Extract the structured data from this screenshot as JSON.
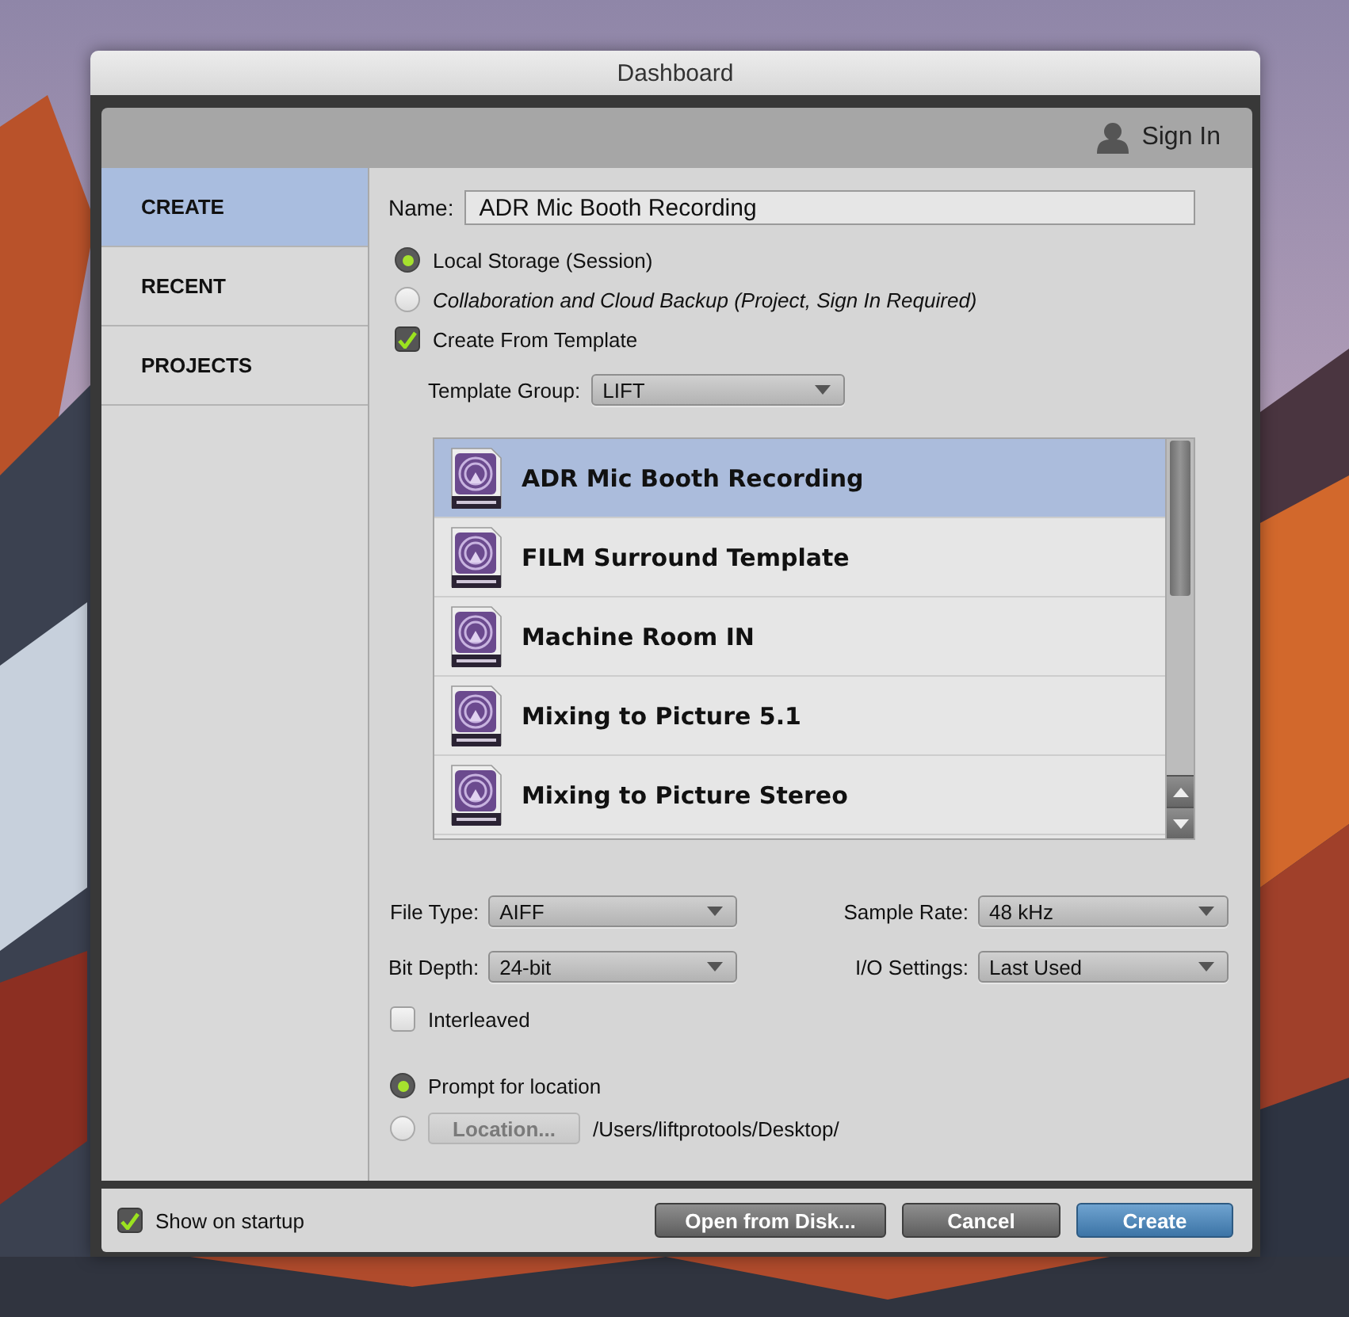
{
  "window": {
    "title": "Dashboard"
  },
  "header": {
    "sign_in": "Sign In"
  },
  "sidebar": {
    "items": [
      {
        "label": "CREATE",
        "selected": true
      },
      {
        "label": "RECENT",
        "selected": false
      },
      {
        "label": "PROJECTS",
        "selected": false
      }
    ]
  },
  "form": {
    "name_label": "Name:",
    "name_value": "ADR Mic Booth Recording",
    "storage_options": [
      {
        "label": "Local Storage (Session)",
        "selected": true,
        "italic": false
      },
      {
        "label": "Collaboration and Cloud Backup (Project, Sign In Required)",
        "selected": false,
        "italic": true
      }
    ],
    "create_from_template": {
      "label": "Create From Template",
      "checked": true
    },
    "template_group": {
      "label": "Template Group:",
      "value": "LIFT"
    },
    "templates": [
      {
        "name": "ADR Mic Booth Recording",
        "selected": true
      },
      {
        "name": "FILM Surround Template",
        "selected": false
      },
      {
        "name": "Machine Room IN",
        "selected": false
      },
      {
        "name": "Mixing to Picture 5.1",
        "selected": false
      },
      {
        "name": "Mixing to Picture Stereo",
        "selected": false
      }
    ],
    "settings": [
      {
        "label": "File Type:",
        "value": "AIFF"
      },
      {
        "label": "Sample Rate:",
        "value": "48 kHz"
      },
      {
        "label": "Bit Depth:",
        "value": "24-bit"
      },
      {
        "label": "I/O Settings:",
        "value": "Last Used"
      }
    ],
    "interleaved": {
      "label": "Interleaved",
      "checked": false
    },
    "location_options": [
      {
        "kind": "prompt",
        "label": "Prompt for location",
        "selected": true
      },
      {
        "kind": "location",
        "button": "Location...",
        "disabled": true,
        "path": "/Users/liftprotools/Desktop/",
        "selected": false
      }
    ]
  },
  "footer": {
    "show_on_startup": {
      "label": "Show on startup",
      "checked": true
    },
    "buttons": [
      {
        "label": "Open from Disk...",
        "kind": "secondary"
      },
      {
        "label": "Cancel",
        "kind": "secondary"
      },
      {
        "label": "Create",
        "kind": "primary"
      }
    ]
  }
}
